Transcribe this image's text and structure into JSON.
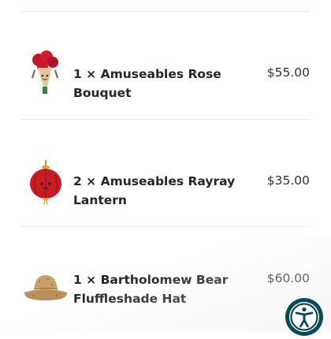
{
  "cart": {
    "items": [
      {
        "qty_text": "1 ×",
        "name": "Amuseables Rose Bouquet",
        "price": "$55.00",
        "image_icon": "rose-bouquet-plush"
      },
      {
        "qty_text": "2 ×",
        "name": "Amuseables Rayray Lantern",
        "price": "$35.00",
        "image_icon": "red-lantern-plush"
      },
      {
        "qty_text": "1 ×",
        "name": "Bartholomew Bear Fluffleshade Hat",
        "price": "$60.00",
        "image_icon": "bucket-hat"
      }
    ]
  },
  "accessibility": {
    "icon": "accessibility-person-icon",
    "color": "#0a4b58"
  }
}
